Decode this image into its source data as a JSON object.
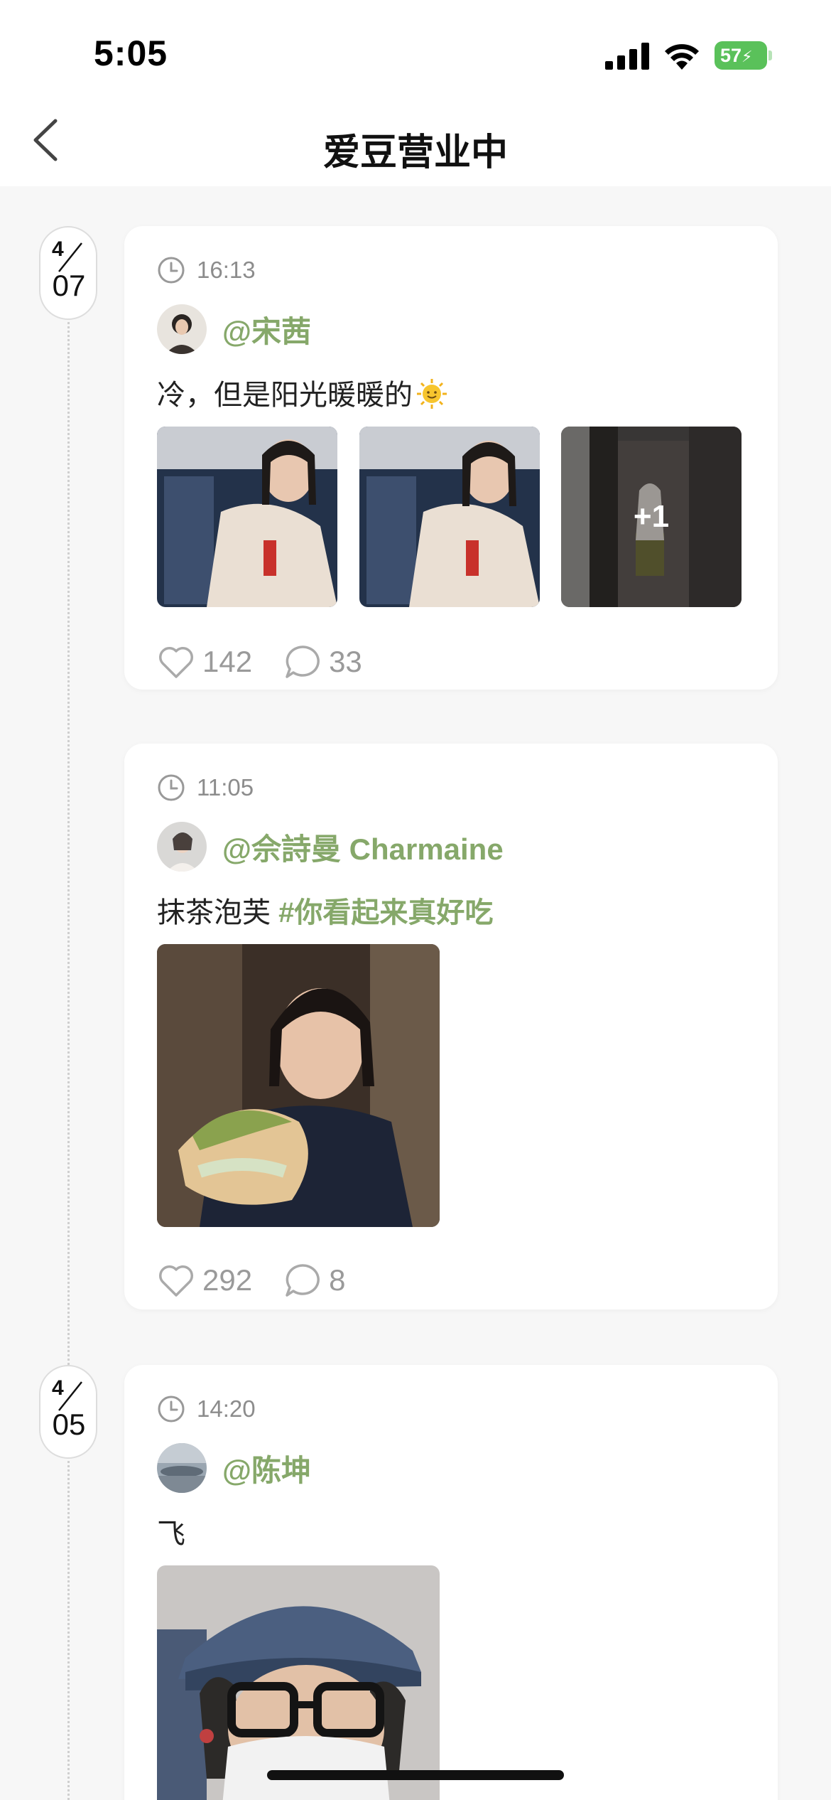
{
  "status_bar": {
    "time": "5:05",
    "battery_level": "57"
  },
  "nav": {
    "title": "爱豆营业中"
  },
  "colors": {
    "accent": "#86a86a",
    "battery": "#5ac15a",
    "muted": "#9a9a9a"
  },
  "dates": [
    {
      "month": "4",
      "day": "07"
    },
    {
      "month": "4",
      "day": "05"
    }
  ],
  "posts": [
    {
      "time": "16:13",
      "username": "@宋茜",
      "text": "冷，但是阳光暖暖的",
      "emoji": "sun-emoji",
      "more_count": "+1",
      "likes": "142",
      "comments": "33"
    },
    {
      "time": "11:05",
      "username": "@佘詩曼 Charmaine",
      "text": "抹茶泡芙",
      "hashtag": "#你看起来真好吃",
      "likes": "292",
      "comments": "8"
    },
    {
      "time": "14:20",
      "username": "@陈坤",
      "text": "飞"
    }
  ]
}
